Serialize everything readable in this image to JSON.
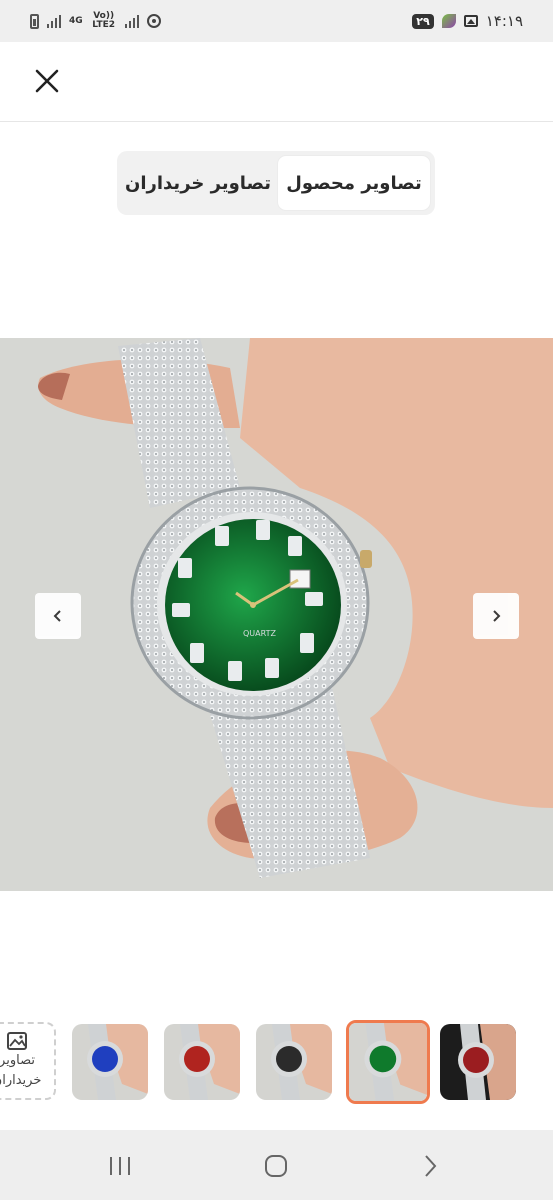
{
  "status_bar": {
    "time": "۱۴:۱۹",
    "badge": "۲۹",
    "network_1": "4G",
    "network_2": "Vo)) LTE2"
  },
  "header": {
    "close_icon": "close-icon"
  },
  "tabs": {
    "product_images": "تصاویر محصول",
    "buyer_images": "تصاویر خریداران",
    "active": "product_images"
  },
  "main_image": {
    "dial_text": "QUARTZ",
    "dial_color": "#0f6a2a"
  },
  "thumbnails": {
    "buyer_tile_line1": "تصاویر",
    "buyer_tile_line2": "خریداران",
    "items": [
      {
        "dial_color": "#1f3fbf"
      },
      {
        "dial_color": "#b0241f"
      },
      {
        "dial_color": "#2b2b2b"
      },
      {
        "dial_color": "#0f7a2c",
        "selected": true
      },
      {
        "dial_color": "#9b1d20"
      }
    ]
  },
  "colors": {
    "accent_selected_border": "#ef7a4e",
    "segment_bg": "#f1f1f1"
  }
}
